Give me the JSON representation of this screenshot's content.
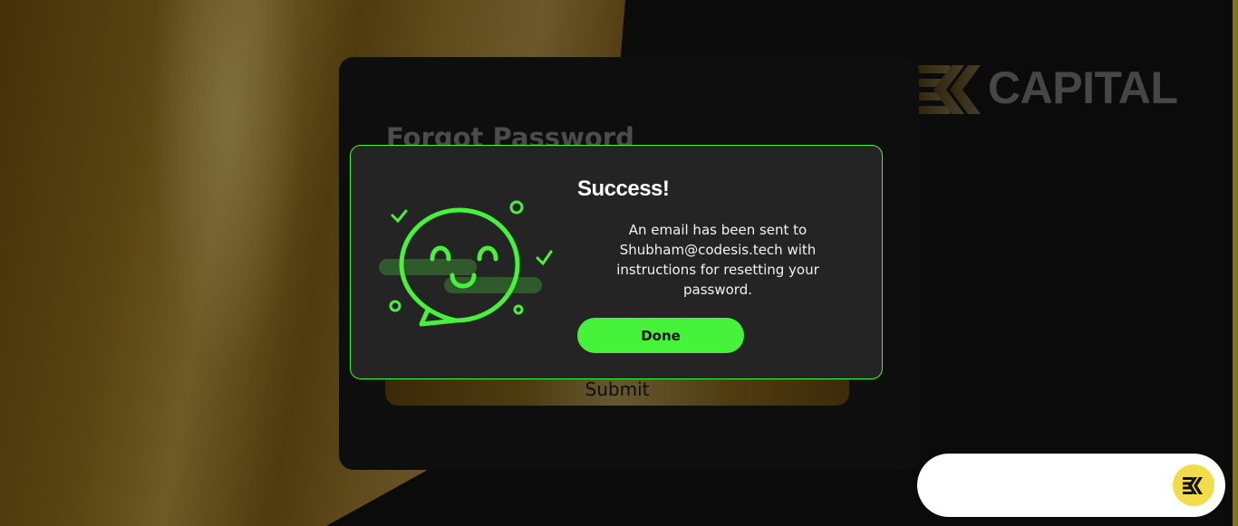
{
  "brand": {
    "name": "CAPITAL"
  },
  "form": {
    "title": "Forgot Password",
    "submit_label": "Submit"
  },
  "modal": {
    "title": "Success!",
    "message": "An email has been sent to Shubham@codesis.tech with instructions for resetting your password.",
    "done_label": "Done",
    "illustration": "smiling-chat-bubble-icon"
  },
  "chat": {
    "launcher_icon": "ek-logo-icon"
  },
  "colors": {
    "accent_green": "#47f23a",
    "gold": "#b08a35",
    "launcher_yellow": "#f3dc4a",
    "card_bg": "#1b1b1b",
    "modal_bg": "#242424"
  }
}
